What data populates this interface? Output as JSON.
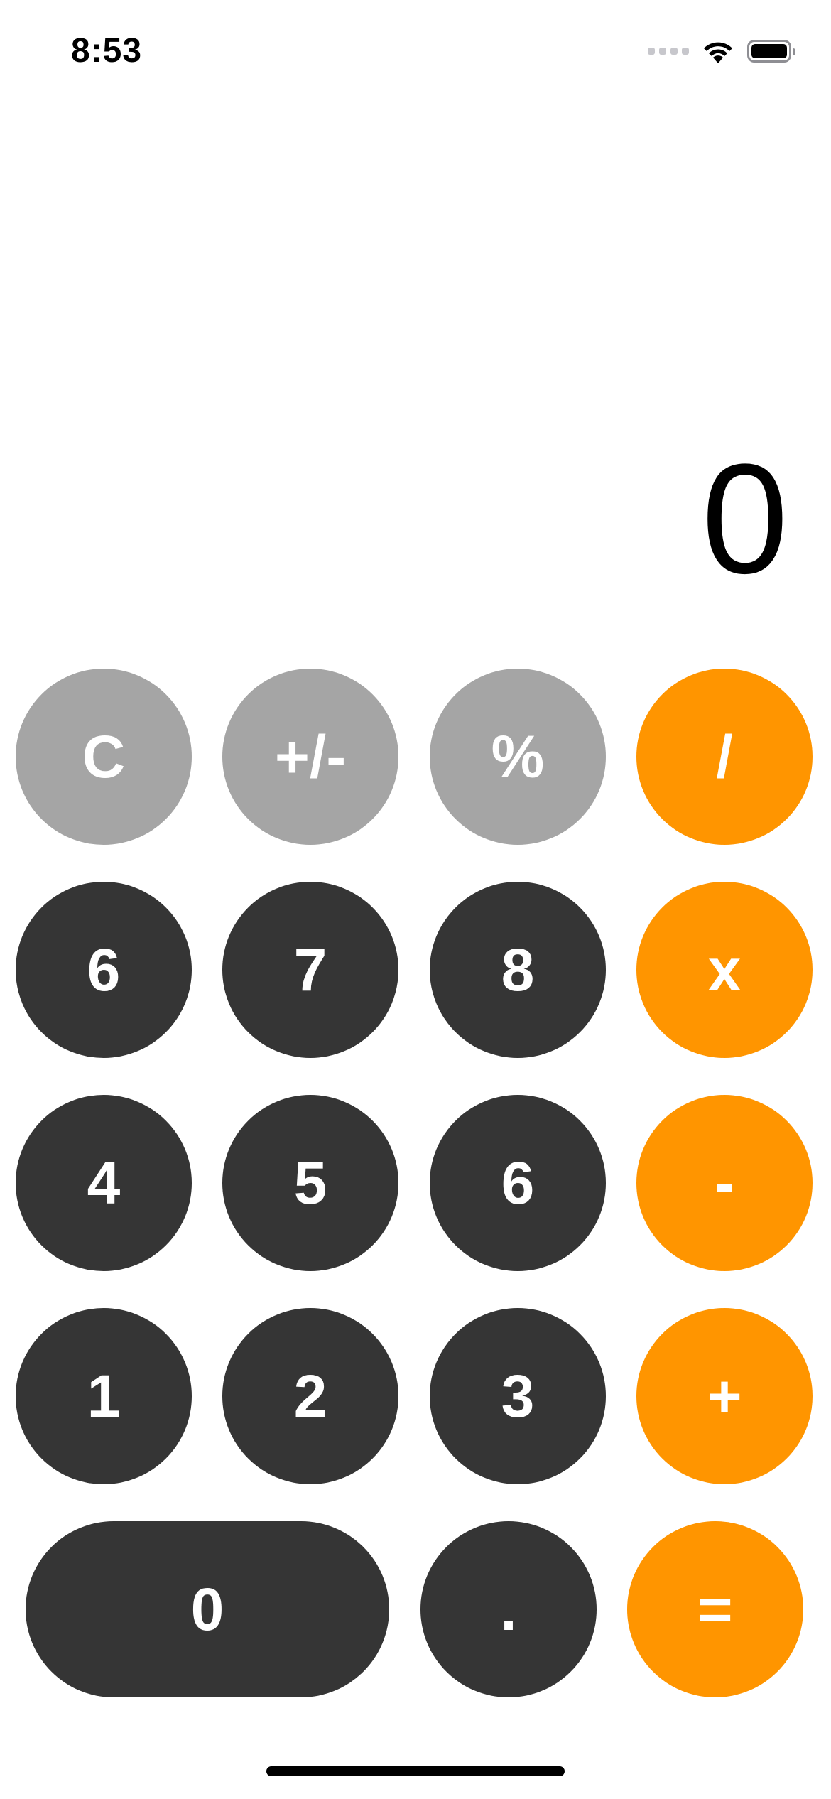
{
  "status_bar": {
    "time": "8:53",
    "battery_icon": "battery-full-icon",
    "wifi_icon": "wifi-icon",
    "signal_icon": "signal-dots-icon"
  },
  "display": {
    "value": "0"
  },
  "keypad": {
    "row1": [
      "C",
      "+/-",
      "%",
      "/"
    ],
    "row2": [
      "6",
      "7",
      "8",
      "x"
    ],
    "row3": [
      "4",
      "5",
      "6",
      "-"
    ],
    "row4": [
      "1",
      "2",
      "3",
      "+"
    ],
    "row5": [
      "0",
      ".",
      "="
    ]
  },
  "colors": {
    "function_key": "#a5a5a5",
    "digit_key": "#353535",
    "operator_key": "#ff9500",
    "key_text": "#ffffff",
    "background": "#ffffff"
  }
}
